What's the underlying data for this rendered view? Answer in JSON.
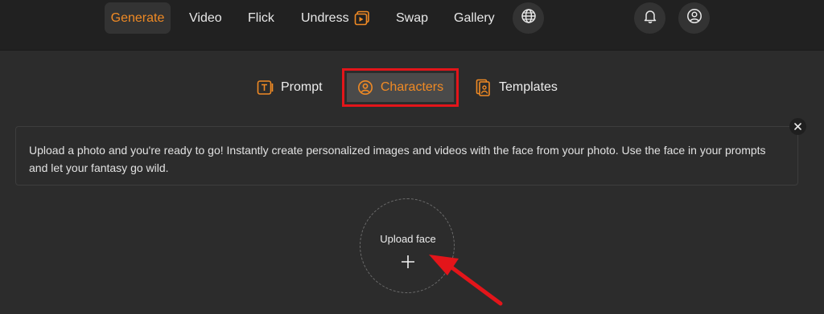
{
  "nav": {
    "items": [
      {
        "label": "Generate",
        "active": true
      },
      {
        "label": "Video"
      },
      {
        "label": "Flick"
      },
      {
        "label": "Undress"
      },
      {
        "label": "Swap"
      },
      {
        "label": "Gallery"
      }
    ],
    "icons": [
      "globe-icon",
      "bell-icon",
      "user-icon"
    ]
  },
  "tabs": {
    "prompt": "Prompt",
    "characters": "Characters",
    "templates": "Templates",
    "selected": "Characters"
  },
  "info": {
    "text": "Upload a photo and you're ready to go! Instantly create personalized images and videos with the face from your photo. Use the face in your prompts and let your fantasy go wild."
  },
  "upload": {
    "label": "Upload face"
  },
  "colors": {
    "accent": "#f08a24",
    "highlight": "#e3151a",
    "background": "#2c2c2c",
    "topbar": "#212121"
  }
}
